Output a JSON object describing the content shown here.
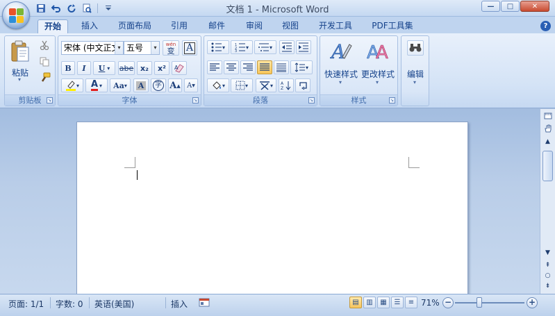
{
  "window": {
    "title": "文档 1 - Microsoft Word",
    "controls": {
      "minimize": "—",
      "maximize": "□",
      "close": "✕"
    }
  },
  "qat": [
    "save-icon",
    "undo-icon",
    "redo-icon",
    "print-preview-icon",
    "customize-icon"
  ],
  "tabs": [
    "开始",
    "插入",
    "页面布局",
    "引用",
    "邮件",
    "审阅",
    "视图",
    "开发工具",
    "PDF工具集"
  ],
  "active_tab": "开始",
  "help": "?",
  "ribbon": {
    "clipboard": {
      "label": "剪贴板",
      "paste": "粘贴"
    },
    "font": {
      "label": "字体",
      "font_name": "宋体 (中文正文",
      "font_size": "五号",
      "wen": "wén",
      "wen_char": "变",
      "border_char": "A",
      "bold": "B",
      "italic": "I",
      "underline": "U",
      "strike": "abe",
      "subscript": "x₂",
      "superscript": "x²",
      "font_color": "A",
      "change_case": "Aa",
      "char_shading": "A",
      "enclose": "字",
      "grow": "A",
      "shrink": "A"
    },
    "paragraph": {
      "label": "段落"
    },
    "styles": {
      "label": "样式",
      "quick_styles": "快速样式",
      "change_styles": "更改样式"
    },
    "editing": {
      "label": "编辑"
    }
  },
  "status": {
    "page": "页面: 1/1",
    "words": "字数: 0",
    "language": "英语(美国)",
    "mode": "插入",
    "zoom": "71%",
    "zoom_minus": "−",
    "zoom_plus": "+"
  }
}
